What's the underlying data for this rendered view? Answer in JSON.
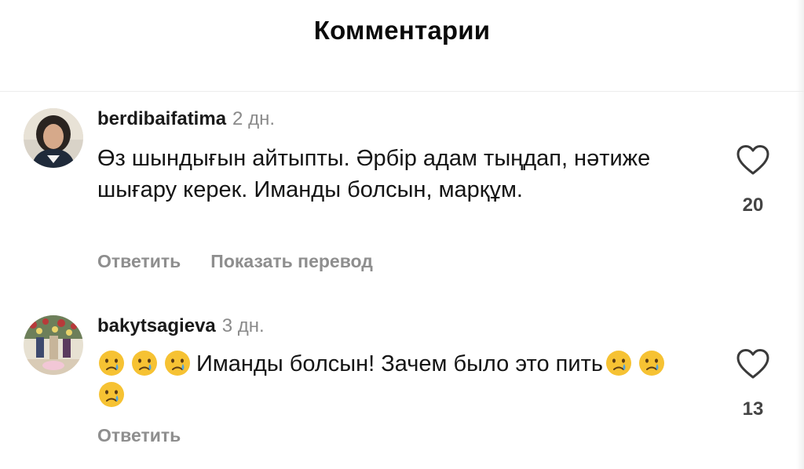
{
  "header": {
    "title": "Комментарии"
  },
  "comments": [
    {
      "username": "berdibaifatima",
      "age": "2 дн.",
      "text": "Өз шындығын айтыпты. Әрбір адам  тыңдап, нәтиже шығару керек. Иманды болсын, марқұм.",
      "likes": "20",
      "actions": {
        "reply": "Ответить",
        "translate": "Показать перевод"
      }
    },
    {
      "username": "bakytsagieva",
      "age": "3 дн.",
      "text_main": "Иманды болсын! Зачем было это пить",
      "emoji_name": "crying-face-emoji",
      "likes": "13",
      "actions": {
        "reply": "Ответить"
      }
    }
  ],
  "icons": {
    "like": "heart-outline-icon"
  },
  "colors": {
    "secondary_text": "#8e8e8e",
    "primary_text": "#141414",
    "emoji_face": "#f6c233",
    "tear": "#4fa3e0"
  }
}
